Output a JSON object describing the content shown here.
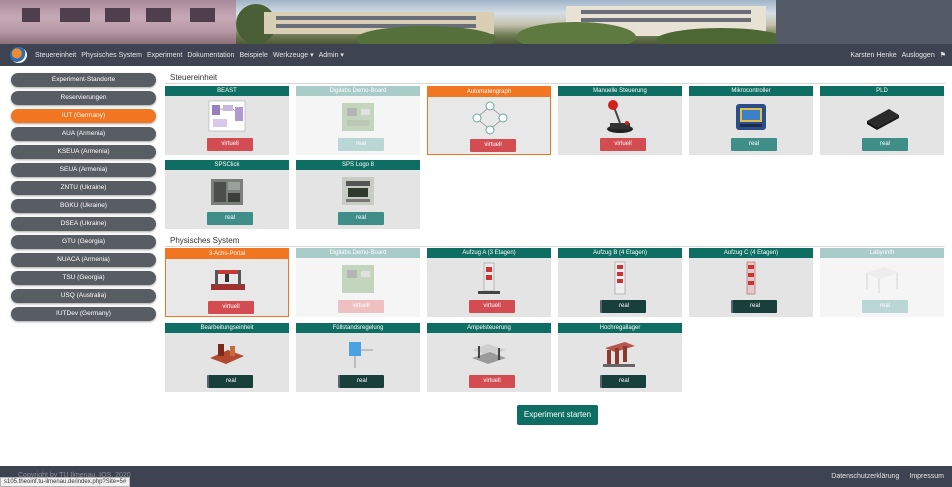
{
  "nav": {
    "items": [
      "Steuereinheit",
      "Physisches System",
      "Experiment",
      "Dokumentation",
      "Beispiele",
      "Werkzeuge ▾",
      "Admin ▾"
    ],
    "user": "Karsten Henke",
    "logout": "Ausloggen",
    "flag_icon": "⚑"
  },
  "sidebar": {
    "items": [
      {
        "label": "Experiment-Standorte",
        "active": false
      },
      {
        "label": "Reservierungen",
        "active": false
      },
      {
        "label": "IUT (Germany)",
        "active": true
      },
      {
        "label": "AUA (Armenia)",
        "active": false
      },
      {
        "label": "KSEUA (Armenia)",
        "active": false
      },
      {
        "label": "SEUA (Armenia)",
        "active": false
      },
      {
        "label": "ZNTU (Ukraine)",
        "active": false
      },
      {
        "label": "BGKU (Ukraine)",
        "active": false
      },
      {
        "label": "DSEA (Ukraine)",
        "active": false
      },
      {
        "label": "GTU (Georgia)",
        "active": false
      },
      {
        "label": "NUACA (Armenia)",
        "active": false
      },
      {
        "label": "TSU (Georgia)",
        "active": false
      },
      {
        "label": "USQ (Australia)",
        "active": false
      },
      {
        "label": "IUTDev (Germany)",
        "active": false
      }
    ]
  },
  "sections": {
    "steuereinheit": "Steuereinheit",
    "physisches": "Physisches System"
  },
  "cards": {
    "beast": {
      "title": "BEAST",
      "button": "virtuell"
    },
    "digilab": {
      "title": "Digilabs Demo-Board",
      "button": "real"
    },
    "automat": {
      "title": "Automatengraph",
      "button": "virtuell"
    },
    "manuell": {
      "title": "Manuelle Steuerung",
      "button": "virtuell"
    },
    "mikro": {
      "title": "Mikrocontroller",
      "button": "real"
    },
    "pld": {
      "title": "PLD",
      "button": "real"
    },
    "spsclick": {
      "title": "SPSClick",
      "button": "real"
    },
    "spslogo": {
      "title": "SPS Logo 8",
      "button": "real"
    },
    "portal": {
      "title": "3-Achs-Portal",
      "button": "virtuell"
    },
    "digilab2": {
      "title": "Digilabs Demo-Board",
      "button": "virtuell"
    },
    "aufzugA": {
      "title": "Aufzug A (3 Etagen)",
      "button": "virtuell"
    },
    "aufzugB": {
      "title": "Aufzug B (4 Etagen)",
      "button": "real"
    },
    "aufzugC": {
      "title": "Aufzug C (4 Etagen)",
      "button": "real"
    },
    "labyrinth": {
      "title": "Labyrinth",
      "button": "real"
    },
    "bearbeitung": {
      "title": "Bearbeitungseinheit",
      "button": "real"
    },
    "fuellstand": {
      "title": "Füllstandsregelung",
      "button": "real"
    },
    "ampel": {
      "title": "Ampelsteuerung",
      "button": "virtuell"
    },
    "hochregal": {
      "title": "Hochregallager",
      "button": "real"
    }
  },
  "start_button": "Experiment starten",
  "footer": {
    "copyright": "Copyright by TU Ilmenau, IOS, 2020",
    "privacy": "Datenschutzerklärung",
    "imprint": "Impressum"
  },
  "statusbar": "s105.theoinf.tu-ilmenau.de/index.php?Site=5#",
  "colors": {
    "accent_orange": "#f27521",
    "teal": "#0f6e63",
    "virtual_red": "#d24c52",
    "real_teal": "#3f8f88",
    "nav_bg": "#3d4350"
  }
}
